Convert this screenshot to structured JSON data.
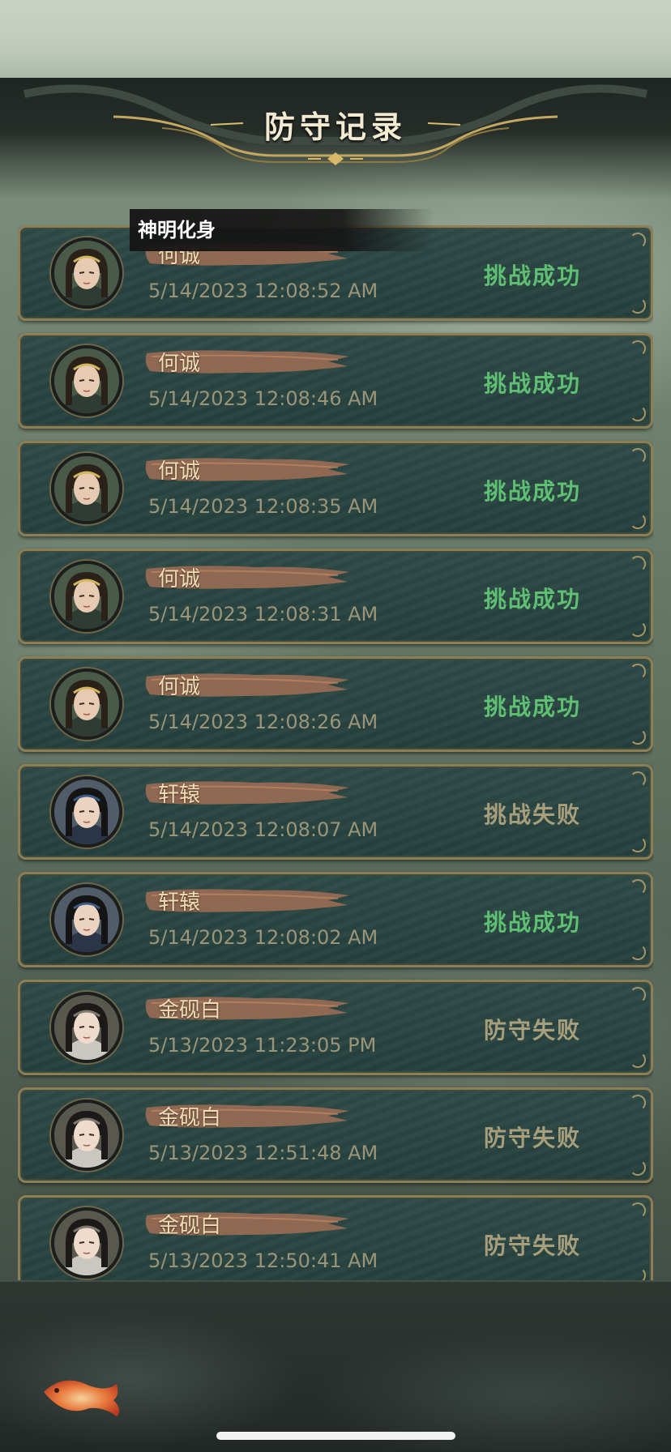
{
  "title": "防守记录",
  "tag": "神明化身",
  "records": [
    {
      "name": "何诚",
      "time": "5/14/2023 12:08:52 AM",
      "result": "挑战成功",
      "status": "success",
      "avatar": "hecheng"
    },
    {
      "name": "何诚",
      "time": "5/14/2023 12:08:46 AM",
      "result": "挑战成功",
      "status": "success",
      "avatar": "hecheng"
    },
    {
      "name": "何诚",
      "time": "5/14/2023 12:08:35 AM",
      "result": "挑战成功",
      "status": "success",
      "avatar": "hecheng"
    },
    {
      "name": "何诚",
      "time": "5/14/2023 12:08:31 AM",
      "result": "挑战成功",
      "status": "success",
      "avatar": "hecheng"
    },
    {
      "name": "何诚",
      "time": "5/14/2023 12:08:26 AM",
      "result": "挑战成功",
      "status": "success",
      "avatar": "hecheng"
    },
    {
      "name": "轩辕",
      "time": "5/14/2023 12:08:07 AM",
      "result": "挑战失败",
      "status": "fail",
      "avatar": "xuanyuan"
    },
    {
      "name": "轩辕",
      "time": "5/14/2023 12:08:02 AM",
      "result": "挑战成功",
      "status": "success",
      "avatar": "xuanyuan"
    },
    {
      "name": "金砚白",
      "time": "5/13/2023 11:23:05 PM",
      "result": "防守失败",
      "status": "fail",
      "avatar": "jinyanbai"
    },
    {
      "name": "金砚白",
      "time": "5/13/2023 12:51:48 AM",
      "result": "防守失败",
      "status": "fail",
      "avatar": "jinyanbai"
    },
    {
      "name": "金砚白",
      "time": "5/13/2023 12:50:41 AM",
      "result": "防守失败",
      "status": "fail",
      "avatar": "jinyanbai"
    }
  ],
  "colors": {
    "success": "#5fbf73",
    "fail": "#a79e7c",
    "card_border": "#8c7f55",
    "card_bg": "#2e4a47",
    "name_text": "#f1ddb5",
    "title_text": "#f3ead2"
  }
}
